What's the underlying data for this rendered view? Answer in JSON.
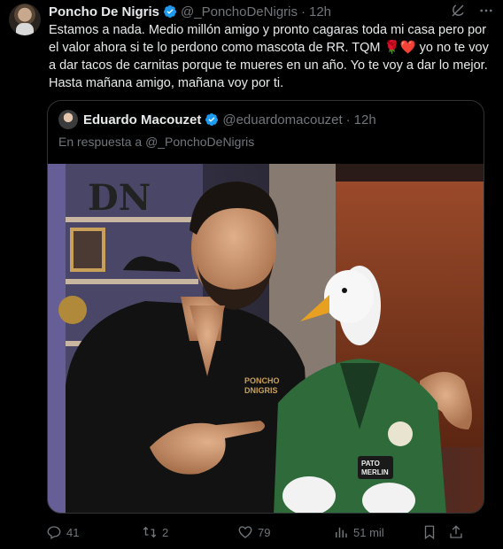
{
  "tweet": {
    "author_name": "Poncho De Nigris",
    "author_handle": "@_PonchoDeNigris",
    "separator": "·",
    "time": "12h",
    "text": "Estamos a nada. Medio millón amigo y pronto cagaras toda mi casa pero por el valor ahora si te lo perdono como mascota de RR.  TQM 🌹❤️ yo no te voy a dar tacos de carnitas porque te mueres en un año. Yo te voy a dar lo mejor. Hasta mañana amigo, mañana voy por ti."
  },
  "quoted": {
    "author_name": "Eduardo Macouzet",
    "author_handle": "@eduardomacouzet",
    "separator": "·",
    "time": "12h",
    "reply_prefix": "En respuesta a ",
    "reply_to": "@_PonchoDeNigris",
    "photo_text": {
      "logo": "DN",
      "shirt_brand_line1": "PONCHO",
      "shirt_brand_line2": "DNIGRIS",
      "patch_line1": "PATO",
      "patch_line2": "MERLIN"
    }
  },
  "actions": {
    "replies": "41",
    "reposts": "2",
    "likes": "79",
    "views": "51 mil"
  },
  "colors": {
    "verified": "#1d9bf0",
    "muted": "#71767b",
    "background": "#000000"
  },
  "icons": [
    "grok-icon",
    "more-icon",
    "reply-icon",
    "repost-icon",
    "like-icon",
    "views-icon",
    "bookmark-icon",
    "share-icon"
  ]
}
